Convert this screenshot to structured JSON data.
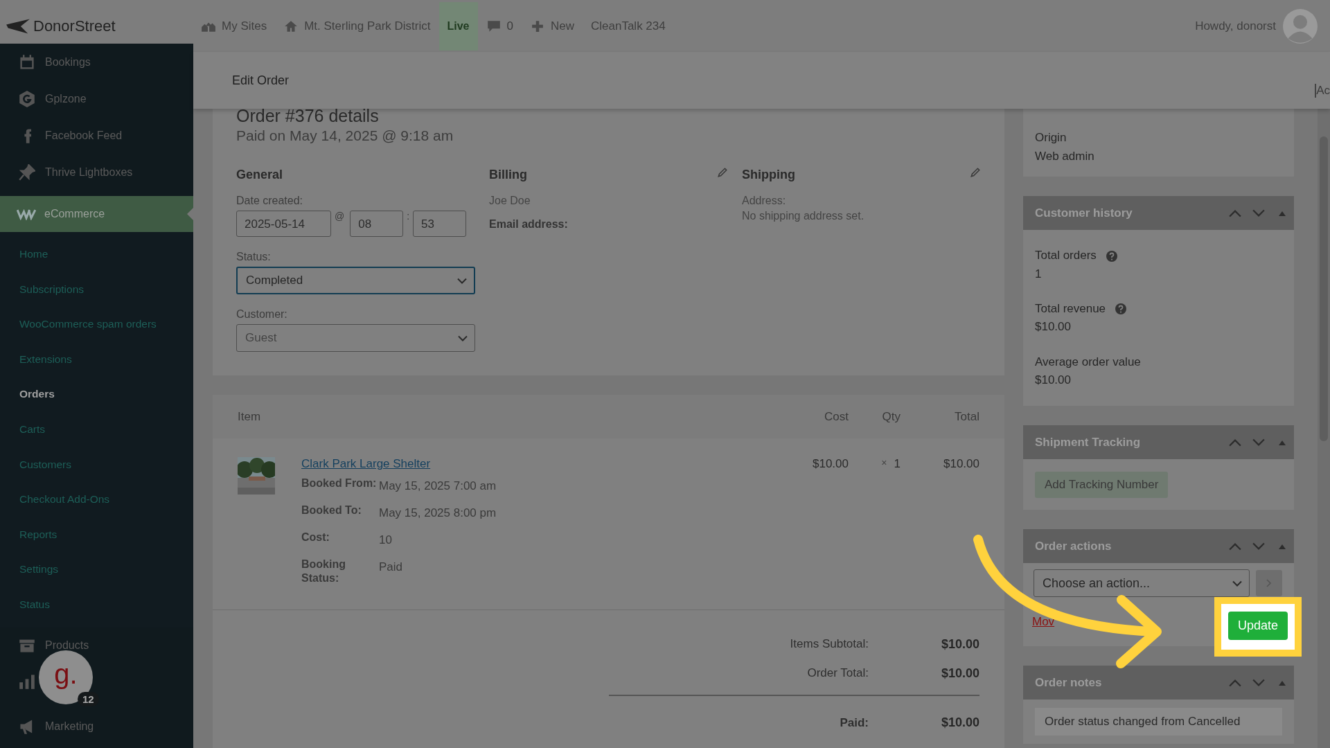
{
  "topbar": {
    "logo": "DonorStreet",
    "items": [
      {
        "kind": "sites",
        "label": "My Sites"
      },
      {
        "kind": "home",
        "label": "Mt. Sterling Park District"
      },
      {
        "kind": "live",
        "label": "Live"
      },
      {
        "kind": "comments",
        "label": "0"
      },
      {
        "kind": "new",
        "label": "New"
      },
      {
        "kind": "plain",
        "label": "CleanTalk 234"
      }
    ],
    "greeting": "Howdy, donorst"
  },
  "sidebar": {
    "items": [
      {
        "kind": "calendar",
        "label": "Bookings"
      },
      {
        "kind": "g",
        "label": "Gplzone"
      },
      {
        "kind": "f",
        "label": "Facebook Feed"
      },
      {
        "kind": "pin",
        "label": "Thrive Lightboxes"
      }
    ],
    "section": {
      "label": "eCommerce",
      "children": [
        {
          "label": "Home",
          "selected": false
        },
        {
          "label": "Subscriptions",
          "selected": false
        },
        {
          "label": "WooCommerce spam orders",
          "selected": false
        },
        {
          "label": "Extensions",
          "selected": false
        },
        {
          "label": "Orders",
          "selected": true
        },
        {
          "label": "Carts",
          "selected": false
        },
        {
          "label": "Customers",
          "selected": false
        },
        {
          "label": "Checkout Add-Ons",
          "selected": false
        },
        {
          "label": "Reports",
          "selected": false
        },
        {
          "label": "Settings",
          "selected": false
        },
        {
          "label": "Status",
          "selected": false
        }
      ]
    },
    "lower_items": [
      {
        "kind": "box",
        "label": "Products"
      },
      {
        "kind": "chart"
      },
      {
        "kind": "megaphone",
        "label": "Marketing"
      }
    ]
  },
  "chat_bubble": {
    "logo": "g.",
    "count": "12"
  },
  "header": {
    "title": "Edit Order",
    "corner": "Ac"
  },
  "order": {
    "title": "Order #376 details",
    "subtitle": "Paid on May 14, 2025 @ 9:18 am",
    "general": {
      "heading": "General",
      "date_label": "Date created:",
      "date": "2025-05-14",
      "at": "@",
      "hour": "08",
      "separator": ":",
      "minute": "53",
      "status_label": "Status:",
      "status": "Completed",
      "customer_label": "Customer:",
      "customer": "Guest"
    },
    "billing": {
      "heading": "Billing",
      "name": "Joe Doe",
      "email_label": "Email address:"
    },
    "shipping": {
      "heading": "Shipping",
      "address_label": "Address:",
      "address": "No shipping address set."
    }
  },
  "items": {
    "columns": [
      "Item",
      "Cost",
      "Qty",
      "Total"
    ],
    "rows": [
      {
        "name": "Clark Park Large Shelter",
        "cost": "$10.00",
        "times": "×",
        "qty": "1",
        "total": "$10.00",
        "meta": [
          {
            "label": "Booked From:",
            "value": "May 15, 2025 7:00 am"
          },
          {
            "label": "Booked To:",
            "value": "May 15, 2025 8:00 pm"
          },
          {
            "label": "Cost:",
            "value": "10"
          },
          {
            "label": "Booking Status:",
            "value": "Paid"
          }
        ]
      }
    ],
    "totals": [
      {
        "kind": "plain",
        "label": "Items Subtotal:",
        "value": "$10.00"
      },
      {
        "kind": "plain",
        "label": "Order Total:",
        "value": "$10.00"
      },
      {
        "kind": "paid",
        "label": "Paid:",
        "value": "$10.00"
      }
    ]
  },
  "side": {
    "origin": {
      "label": "Origin",
      "value": "Web admin"
    },
    "history": {
      "title": "Customer history",
      "stats": [
        {
          "label": "Total orders",
          "help": true,
          "value": "1"
        },
        {
          "label": "Total revenue",
          "help": true,
          "value": "$10.00"
        },
        {
          "label": "Average order value",
          "help": false,
          "value": "$10.00"
        }
      ]
    },
    "tracking": {
      "title": "Shipment Tracking",
      "button": "Add Tracking Number"
    },
    "actions": {
      "title": "Order actions",
      "select": "Choose an action...",
      "link": "Mov",
      "button": "Update"
    },
    "notes": {
      "title": "Order notes",
      "note": "Order status changed from Cancelled"
    }
  }
}
